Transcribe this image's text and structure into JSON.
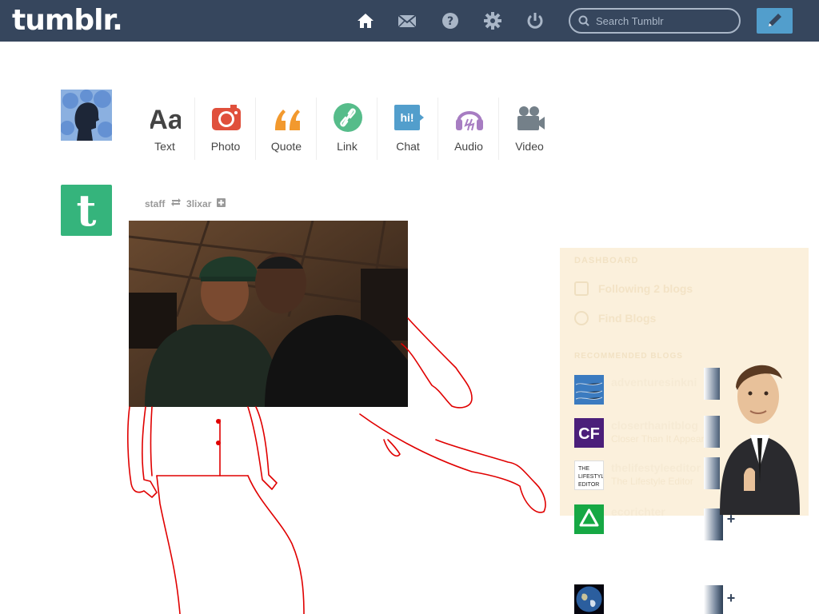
{
  "header": {
    "logo": "tumblr.",
    "icons": [
      "home-icon",
      "mail-icon",
      "help-icon",
      "gear-icon",
      "power-icon"
    ],
    "search": {
      "placeholder": "Search Tumblr",
      "value": ""
    },
    "compose_icon": "pencil-icon"
  },
  "post_types": [
    {
      "label": "Text",
      "icon": "text-icon"
    },
    {
      "label": "Photo",
      "icon": "camera-icon"
    },
    {
      "label": "Quote",
      "icon": "quote-icon"
    },
    {
      "label": "Link",
      "icon": "link-icon"
    },
    {
      "label": "Chat",
      "icon": "chat-icon"
    },
    {
      "label": "Audio",
      "icon": "headphones-icon"
    },
    {
      "label": "Video",
      "icon": "video-camera-icon"
    }
  ],
  "post": {
    "avatar_letter": "t",
    "author": "staff",
    "reblogged_from": "3lixar",
    "reblog_icon": "reblog-icon",
    "follow_icon": "plus-icon"
  },
  "sidebar": {
    "section_title": "DASHBOARD",
    "links": [
      {
        "label": "Following 2 blogs",
        "icon": "following-icon"
      },
      {
        "label": "Find Blogs",
        "icon": "find-blogs-icon"
      }
    ],
    "recommended_title": "RECOMMENDED BLOGS",
    "recommended": [
      {
        "name": "adventuresinkni",
        "desc": "",
        "avatar_label": ""
      },
      {
        "name": "closerthanitblog",
        "desc": "Closer Than It Appears",
        "avatar_label": "CF"
      },
      {
        "name": "thelifestyleeditor",
        "desc": "The Lifestyle Editor",
        "avatar_label": "THE LIFESTYLE EDITOR"
      },
      {
        "name": "ecorichter",
        "desc": "",
        "avatar_label": ""
      },
      {
        "name": "",
        "desc": "",
        "avatar_label": ""
      }
    ]
  },
  "colors": {
    "header_bg": "#36465d",
    "compose_bg": "#529ecc",
    "staff_green": "#35b47c",
    "photo_red": "#e0503c",
    "quote_orange": "#f2992e",
    "link_green": "#56bc8a",
    "chat_blue": "#529ecc",
    "audio_purple": "#a77dc2",
    "video_gray": "#748089",
    "sketch_red": "#e00000"
  }
}
